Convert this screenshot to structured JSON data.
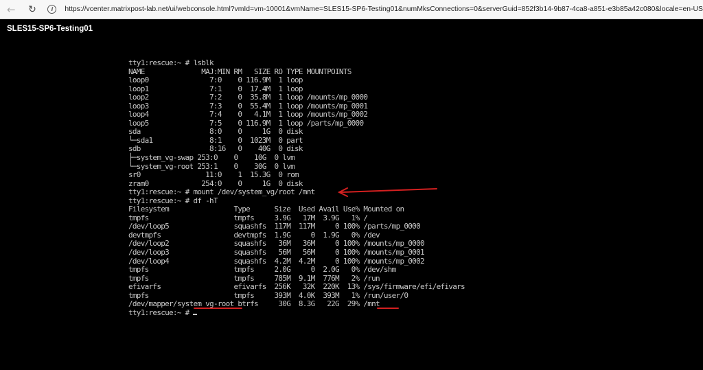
{
  "browser": {
    "back_icon": "arrow-left-icon",
    "reload_icon": "reload-icon",
    "info_icon": "info-icon",
    "url": "https://vcenter.matrixpost-lab.net/ui/webconsole.html?vmId=vm-10001&vmName=SLES15-SP6-Testing01&numMksConnections=0&serverGuid=852f3b14-9b87-4ca8-a851-e3b85a42c080&locale=en-US"
  },
  "console": {
    "vm_name": "SLES15-SP6-Testing01",
    "lines": [
      "tty1:rescue:~ # lsblk",
      "NAME              MAJ:MIN RM   SIZE RO TYPE MOUNTPOINTS",
      "loop0               7:0    0 116.9M  1 loop",
      "loop1               7:1    0  17.4M  1 loop",
      "loop2               7:2    0  35.8M  1 loop /mounts/mp_0000",
      "loop3               7:3    0  55.4M  1 loop /mounts/mp_0001",
      "loop4               7:4    0   4.1M  1 loop /mounts/mp_0002",
      "loop5               7:5    0 116.9M  1 loop /parts/mp_0000",
      "sda                 8:0    0     1G  0 disk",
      "└─sda1              8:1    0  1023M  0 part",
      "sdb                 8:16   0    40G  0 disk",
      "├─system_vg-swap 253:0    0    10G  0 lvm",
      "└─system_vg-root 253:1    0    30G  0 lvm",
      "sr0                11:0    1  15.3G  0 rom",
      "zram0             254:0    0     1G  0 disk",
      "tty1:rescue:~ # mount /dev/system_vg/root /mnt",
      "tty1:rescue:~ # df -hT",
      "Filesystem                Type      Size  Used Avail Use% Mounted on",
      "tmpfs                     tmpfs     3.9G   17M  3.9G   1% /",
      "/dev/loop5                squashfs  117M  117M     0 100% /parts/mp_0000",
      "devtmpfs                  devtmpfs  1.9G     0  1.9G   0% /dev",
      "/dev/loop2                squashfs   36M   36M     0 100% /mounts/mp_0000",
      "/dev/loop3                squashfs   56M   56M     0 100% /mounts/mp_0001",
      "/dev/loop4                squashfs  4.2M  4.2M     0 100% /mounts/mp_0002",
      "tmpfs                     tmpfs     2.0G     0  2.0G   0% /dev/shm",
      "tmpfs                     tmpfs     785M  9.1M  776M   2% /run",
      "efivarfs                  efivarfs  256K   32K  220K  13% /sys/firmware/efi/efivars",
      "tmpfs                     tmpfs     393M  4.0K  393M   1% /run/user/0",
      "/dev/mapper/system_vg-root btrfs     30G  8.3G   22G  29% /mnt",
      "tty1:rescue:~ # "
    ]
  },
  "colors": {
    "terminal_bg": "#000000",
    "terminal_fg": "#c8c8c8",
    "annotation": "#d42020"
  }
}
